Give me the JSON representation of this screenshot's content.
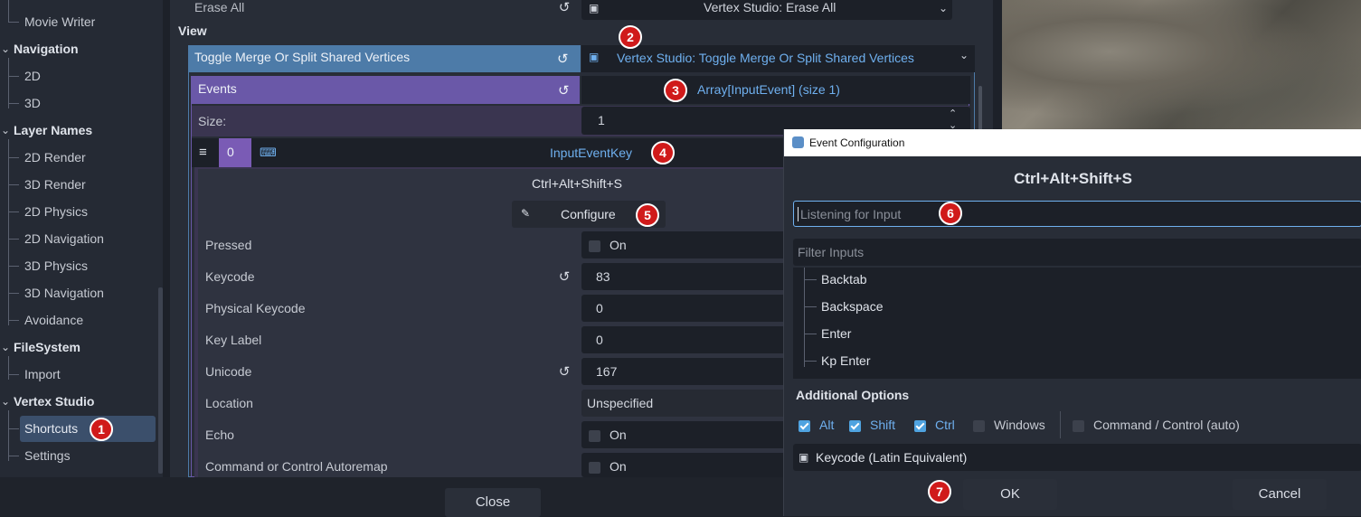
{
  "tree": {
    "items": [
      {
        "label": "Movie Writer",
        "kind": "child"
      },
      {
        "label": "Navigation",
        "kind": "category"
      },
      {
        "label": "2D",
        "kind": "child"
      },
      {
        "label": "3D",
        "kind": "child"
      },
      {
        "label": "Layer Names",
        "kind": "category"
      },
      {
        "label": "2D Render",
        "kind": "child"
      },
      {
        "label": "3D Render",
        "kind": "child"
      },
      {
        "label": "2D Physics",
        "kind": "child"
      },
      {
        "label": "2D Navigation",
        "kind": "child"
      },
      {
        "label": "3D Physics",
        "kind": "child"
      },
      {
        "label": "3D Navigation",
        "kind": "child"
      },
      {
        "label": "Avoidance",
        "kind": "child"
      },
      {
        "label": "FileSystem",
        "kind": "category"
      },
      {
        "label": "Import",
        "kind": "child"
      },
      {
        "label": "Vertex Studio",
        "kind": "category"
      },
      {
        "label": "Shortcuts",
        "kind": "child",
        "selected": true
      },
      {
        "label": "Settings",
        "kind": "child"
      }
    ]
  },
  "inspector": {
    "erase_label": "Erase All",
    "erase_value": "Vertex Studio: Erase All",
    "section_view": "View",
    "toggle_label": "Toggle Merge Or Split Shared Vertices",
    "toggle_value": "Vertex Studio: Toggle Merge Or Split Shared Vertices",
    "events_label": "Events",
    "events_value": "Array[InputEvent] (size 1)",
    "size_label": "Size:",
    "size_value": "1",
    "index_value": "0",
    "event_type": "InputEventKey",
    "shortcut_text": "Ctrl+Alt+Shift+S",
    "configure_label": "Configure",
    "props": [
      {
        "label": "Pressed",
        "value": "On",
        "checkbox": true,
        "revert": false
      },
      {
        "label": "Keycode",
        "value": "83",
        "checkbox": false,
        "revert": true
      },
      {
        "label": "Physical Keycode",
        "value": "0",
        "checkbox": false,
        "revert": false
      },
      {
        "label": "Key Label",
        "value": "0",
        "checkbox": false,
        "revert": false
      },
      {
        "label": "Unicode",
        "value": "167",
        "checkbox": false,
        "revert": true
      },
      {
        "label": "Location",
        "value": "Unspecified",
        "checkbox": false,
        "revert": false
      },
      {
        "label": "Echo",
        "value": "On",
        "checkbox": true,
        "revert": false
      },
      {
        "label": "Command or Control Autoremap",
        "value": "On",
        "checkbox": true,
        "revert": false
      }
    ]
  },
  "footer": {
    "close_label": "Close"
  },
  "dialog": {
    "title": "Event Configuration",
    "shortcut_display": "Ctrl+Alt+Shift+S",
    "listen_placeholder": "Listening for Input",
    "filter_placeholder": "Filter Inputs",
    "list_items": [
      "Backtab",
      "Backspace",
      "Enter",
      "Kp Enter"
    ],
    "additional_options": "Additional Options",
    "modifiers": [
      {
        "label": "Alt",
        "checked": true
      },
      {
        "label": "Shift",
        "checked": true
      },
      {
        "label": "Ctrl",
        "checked": true
      },
      {
        "label": "Windows",
        "checked": false
      }
    ],
    "command_control": "Command / Control (auto)",
    "keycode_mode": "Keycode (Latin Equivalent)",
    "ok_label": "OK",
    "cancel_label": "Cancel"
  },
  "badges": [
    "1",
    "2",
    "3",
    "4",
    "5",
    "6",
    "7"
  ],
  "colors": {
    "accent_blue": "#4d7ba8",
    "events_purple": "#6a58a8",
    "link_blue": "#6fb0ef",
    "badge_red": "#d01a1a"
  }
}
